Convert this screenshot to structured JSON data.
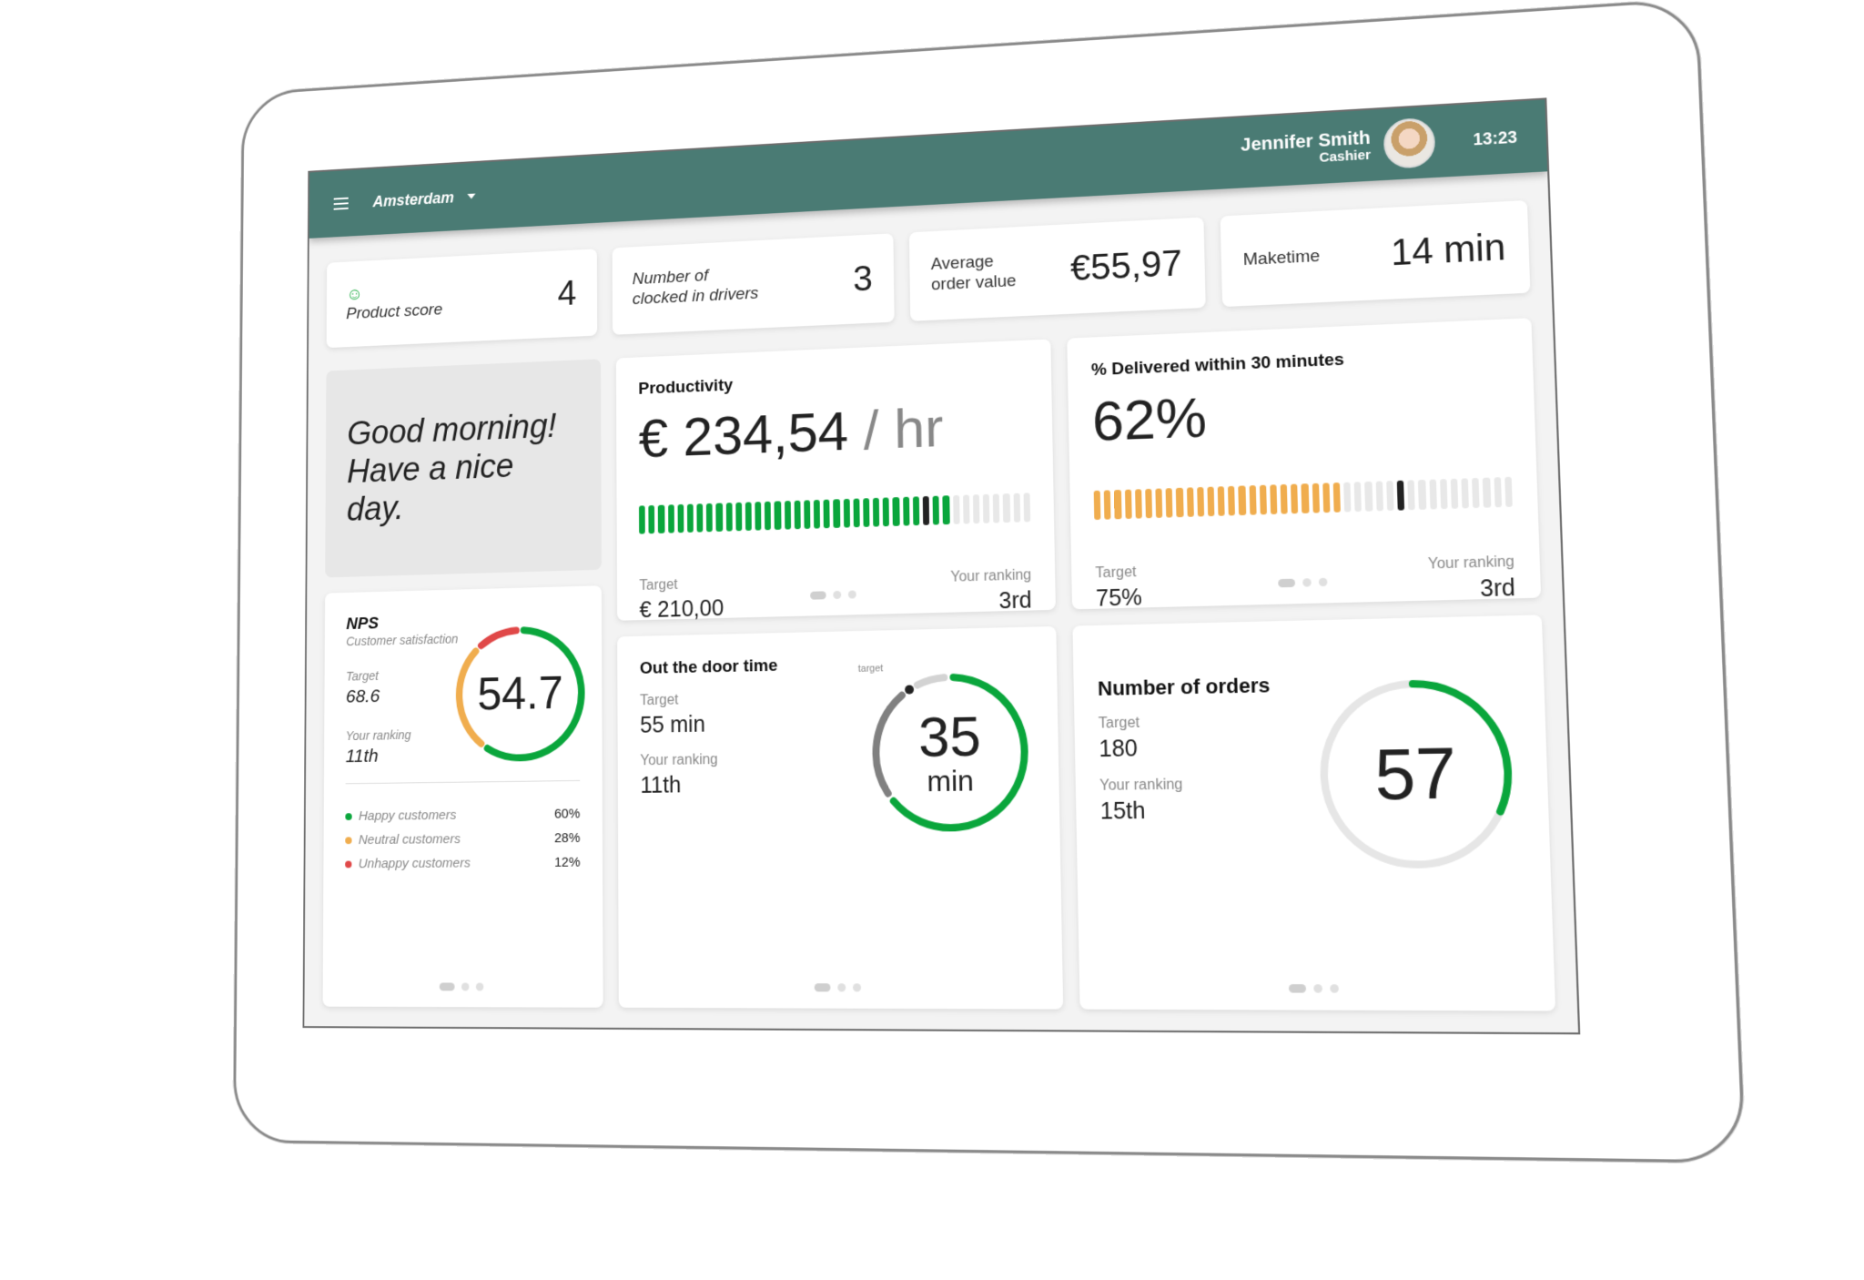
{
  "header": {
    "location": "Amsterdam",
    "user_name": "Jennifer Smith",
    "user_role": "Cashier",
    "time": "13:23",
    "color": "#4a7b74"
  },
  "kpis": [
    {
      "label": "Product score",
      "value": "4",
      "icon": "smiley-icon"
    },
    {
      "label_line1": "Number of",
      "label_line2": "clocked in drivers",
      "value": "3"
    },
    {
      "label_line1": "Average",
      "label_line2": "order value",
      "value": "€55,97"
    },
    {
      "label": "Maketime",
      "value": "14 min"
    }
  ],
  "greeting": {
    "line1": "Good morning!",
    "line2": "Have a nice day."
  },
  "productivity": {
    "title": "Productivity",
    "value": "€ 234,54",
    "unit": " / hr",
    "bar": {
      "segments": 40,
      "filled": 32,
      "target_index": 29,
      "fill_color": "#0aa63c",
      "target_color": "#222222",
      "empty_color": "#e8e8e8"
    },
    "target_label": "Target",
    "target_value": "€ 210,00",
    "ranking_label": "Your ranking",
    "ranking_value": "3rd"
  },
  "delivered": {
    "title": "% Delivered within 30 minutes",
    "value": "62%",
    "bar": {
      "segments": 40,
      "filled": 24,
      "target_index": 29,
      "fill_color": "#f0ad4e",
      "target_color": "#222222",
      "empty_color": "#e8e8e8"
    },
    "target_label": "Target",
    "target_value": "75%",
    "ranking_label": "Your ranking",
    "ranking_value": "3rd"
  },
  "nps": {
    "title": "NPS",
    "subtitle": "Customer satisfaction",
    "target_label": "Target",
    "target_value": "68.6",
    "ranking_label": "Your ranking",
    "ranking_value": "11th",
    "score": "54.7",
    "breakdown": [
      {
        "label": "Happy customers",
        "value": "60%",
        "fraction": 0.6,
        "color": "#0aa63c"
      },
      {
        "label": "Neutral customers",
        "value": "28%",
        "fraction": 0.28,
        "color": "#f0ad4e"
      },
      {
        "label": "Unhappy customers",
        "value": "12%",
        "fraction": 0.12,
        "color": "#e04848"
      }
    ]
  },
  "out_the_door": {
    "title": "Out the door time",
    "target_label": "Target",
    "target_value": "55 min",
    "ranking_label": "Your ranking",
    "ranking_value": "11th",
    "value": "35",
    "unit": "min",
    "marker_label": "target",
    "value_fraction": 0.64,
    "target_fraction": 0.91
  },
  "orders": {
    "title": "Number of orders",
    "target_label": "Target",
    "target_value": "180",
    "ranking_label": "Your ranking",
    "ranking_value": "15th",
    "value": "57",
    "fraction": 0.32
  },
  "pagination": {
    "pages": 3,
    "active": 0
  }
}
